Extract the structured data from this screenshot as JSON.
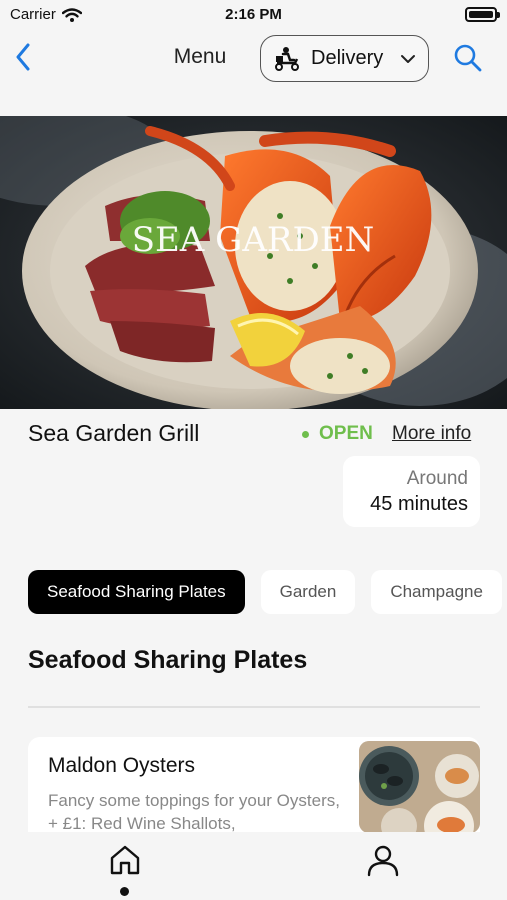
{
  "status_bar": {
    "carrier": "Carrier",
    "time": "2:16 PM"
  },
  "nav": {
    "title": "Menu",
    "delivery_label": "Delivery"
  },
  "hero": {
    "logo_text": "SEA GARDEN"
  },
  "restaurant": {
    "name": "Sea Garden Grill",
    "status": "OPEN",
    "more_info": "More info",
    "time_prefix": "Around",
    "time_value": "45 minutes"
  },
  "categories": [
    {
      "label": "Seafood Sharing Plates",
      "active": true
    },
    {
      "label": "Garden",
      "active": false
    },
    {
      "label": "Champagne",
      "active": false
    }
  ],
  "section": {
    "title": "Seafood Sharing Plates"
  },
  "items": [
    {
      "name": "Maldon Oysters",
      "description": "Fancy some toppings for your Oysters, + £1: Red Wine Shallots,"
    }
  ],
  "colors": {
    "open_green": "#6fbe4c",
    "accent_blue": "#1f7ae0",
    "active_chip": "#000000"
  },
  "icons": {
    "back": "chevron-left-icon",
    "delivery": "scooter-icon",
    "dropdown": "chevron-down-icon",
    "search": "search-icon",
    "home": "home-icon",
    "profile": "person-icon"
  }
}
